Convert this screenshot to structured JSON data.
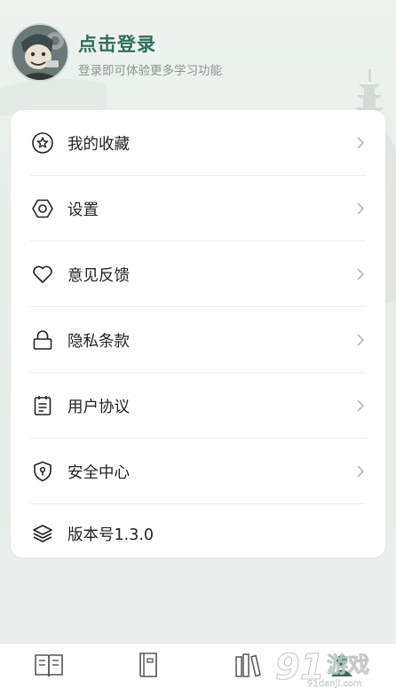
{
  "header": {
    "title": "点击登录",
    "subtitle": "登录即可体验更多学习功能"
  },
  "menu": [
    {
      "label": "我的收藏",
      "icon": "star-icon"
    },
    {
      "label": "设置",
      "icon": "hexagon-settings-icon"
    },
    {
      "label": "意见反馈",
      "icon": "heart-icon"
    },
    {
      "label": "隐私条款",
      "icon": "lock-icon"
    },
    {
      "label": "用户协议",
      "icon": "document-icon"
    },
    {
      "label": "安全中心",
      "icon": "shield-icon"
    },
    {
      "label": "版本号1.3.0",
      "icon": "layers-icon"
    }
  ],
  "tabs": [
    {
      "label": "",
      "icon": "open-book-icon"
    },
    {
      "label": "",
      "icon": "book-icon"
    },
    {
      "label": "",
      "icon": "bookshelf-icon"
    },
    {
      "label": "",
      "icon": "profile-icon"
    }
  ],
  "watermark": {
    "text": "游戏",
    "number": "91",
    "url": "91danji.com"
  },
  "colors": {
    "accent": "#2f6e5f",
    "background": "#eaefec",
    "card": "#ffffff",
    "text": "#222222"
  }
}
